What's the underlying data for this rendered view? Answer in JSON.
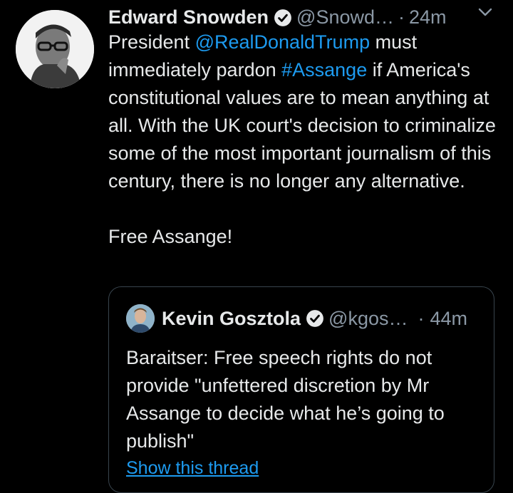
{
  "tweet": {
    "author_name": "Edward Snowden",
    "handle": "@Snowd…",
    "separator": "·",
    "time": "24m",
    "avatar_icon": "profile-photo",
    "text_parts": [
      "President ",
      "@RealDonaldTrump",
      " must immediately pardon ",
      "#Assange",
      " if America's constitutional values are to mean anything at all. With the UK court's decision to criminalize some of the most important journalism of this century, there is no longer any alternative.\n\nFree Assange!"
    ]
  },
  "quoted_tweet": {
    "author_name": "Kevin Gosztola",
    "handle": "@kgos…",
    "separator": "·",
    "time": "44m",
    "text": "Baraitser: Free speech rights do not provide \"unfettered discretion by Mr Assange to decide what he’s going to publish\"",
    "show_thread_label": "Show this thread"
  },
  "colors": {
    "background": "#000000",
    "text": "#e7e9ea",
    "secondary": "#8b98a5",
    "link": "#1d9bf0",
    "border": "#38444d"
  }
}
